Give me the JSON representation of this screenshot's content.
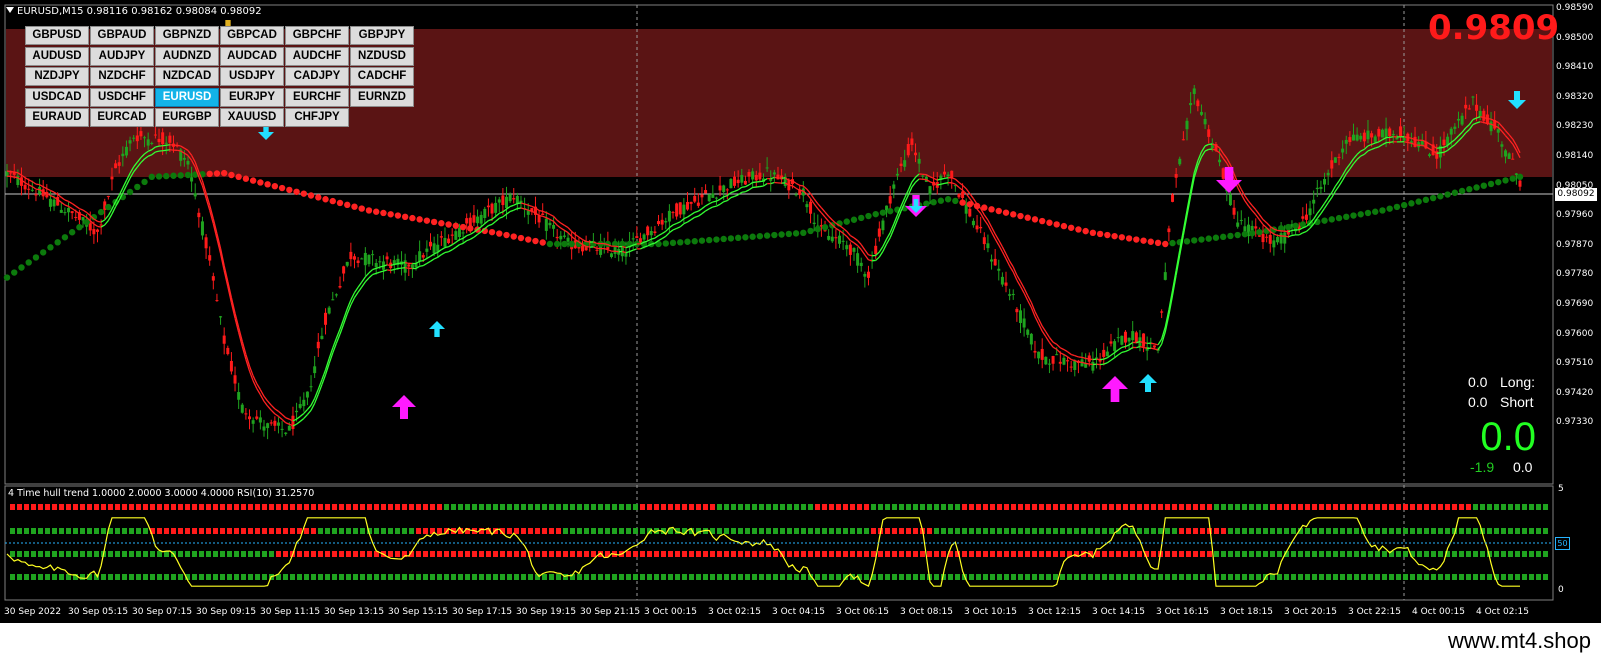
{
  "window": {
    "title": "EURUSD,M15  0.98116 0.98162 0.98084 0.98092"
  },
  "big_price": "0.9809",
  "current_price_label": "0.98092",
  "pairs": [
    [
      "GBPUSD",
      "GBPAUD",
      "GBPNZD",
      "GBPCAD",
      "GBPCHF",
      "GBPJPY"
    ],
    [
      "AUDUSD",
      "AUDJPY",
      "AUDNZD",
      "AUDCAD",
      "AUDCHF",
      "NZDUSD"
    ],
    [
      "NZDJPY",
      "NZDCHF",
      "NZDCAD",
      "USDJPY",
      "CADJPY",
      "CADCHF"
    ],
    [
      "USDCAD",
      "USDCHF",
      "EURUSD",
      "EURJPY",
      "EURCHF",
      "EURNZD"
    ],
    [
      "EURAUD",
      "EURCAD",
      "EURGBP",
      "XAUUSD",
      "CHFJPY"
    ]
  ],
  "active_pair": "EURUSD",
  "y_axis_labels": [
    "0.98590",
    "0.98500",
    "0.98410",
    "0.98320",
    "0.98230",
    "0.98140",
    "0.98050",
    "0.97960",
    "0.97870",
    "0.97780",
    "0.97690",
    "0.97600",
    "0.97510",
    "0.97420",
    "0.97330"
  ],
  "x_axis_labels": [
    "30 Sep 2022",
    "30 Sep 05:15",
    "30 Sep 07:15",
    "30 Sep 09:15",
    "30 Sep 11:15",
    "30 Sep 13:15",
    "30 Sep 15:15",
    "30 Sep 17:15",
    "30 Sep 19:15",
    "30 Sep 21:15",
    "3 Oct 00:15",
    "3 Oct 02:15",
    "3 Oct 04:15",
    "3 Oct 06:15",
    "3 Oct 08:15",
    "3 Oct 10:15",
    "3 Oct 12:15",
    "3 Oct 14:15",
    "3 Oct 16:15",
    "3 Oct 18:15",
    "3 Oct 20:15",
    "3 Oct 22:15",
    "4 Oct 00:15",
    "4 Oct 02:15"
  ],
  "subwindow": {
    "title": "4 Time hull trend 1.0000 2.0000 3.0000 4.0000  RSI(10) 31.2570",
    "scale_top": "5",
    "scale_bottom": "0",
    "rsi_level": "50"
  },
  "stats": {
    "long_value": "0.0",
    "long_label": "Long:",
    "short_value": "0.0",
    "short_label": "Short",
    "big_value": "0.0",
    "diff_value": "-1.9",
    "diff_value2": "0.0"
  },
  "colors": {
    "background": "#000000",
    "bull": "#1fa31f",
    "bear": "#ff1a1a",
    "zone": "#5a1414",
    "hull_up": "#33ff33",
    "hull_down": "#ff2222",
    "slow_ma": "#0c7a0c",
    "rsi": "#ffff22",
    "arrow_magenta": "#ff1aff",
    "arrow_cyan": "#22e0ff",
    "accent_button": "#13b3e8"
  },
  "footer": {
    "watermark": "www.mt4.shop"
  }
}
